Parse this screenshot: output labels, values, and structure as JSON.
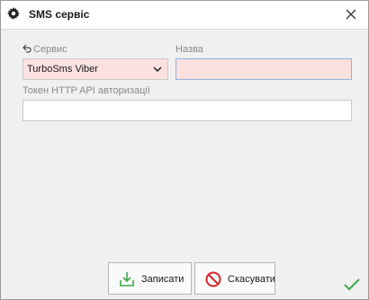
{
  "window": {
    "title": "SMS сервіс",
    "title_icon": "gear-icon",
    "close_icon": "close-icon"
  },
  "form": {
    "service_label": "Сервис",
    "service_value": "TurboSms Viber",
    "name_label": "Назва",
    "name_value": "",
    "token_label": "Токен HTTP API авторизації",
    "token_value": ""
  },
  "buttons": {
    "save_label": "Записати",
    "cancel_label": "Скасувати"
  },
  "colors": {
    "required_field_bg": "#fde0e0",
    "save_icon": "#3aa84a",
    "cancel_icon": "#d9232e",
    "status_check": "#3aa84a"
  }
}
